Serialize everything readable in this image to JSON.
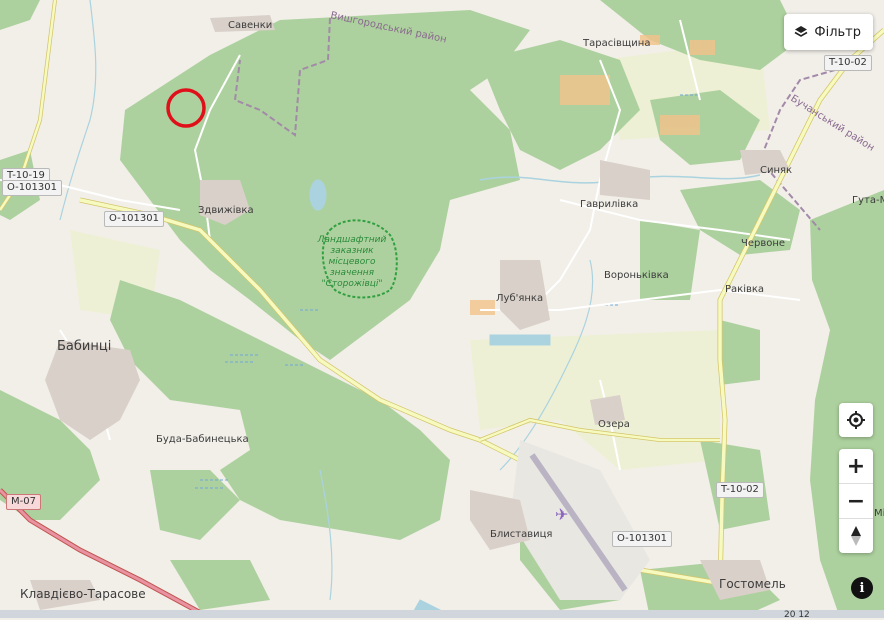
{
  "map": {
    "place_labels": {
      "savenky": "Савенки",
      "zdvyzhivka": "Здвижівка",
      "babyntsi": "Бабинці",
      "buda_babynetska": "Буда-Бабинецька",
      "kladivo_tarasove": "Клавдієво-Тарасове",
      "tarasivshchyna": "Тарасівщина",
      "havrylivka": "Гаврилівка",
      "syniak": "Синяк",
      "huta_m": "Гута-М",
      "chervone": "Червоне",
      "vorontsivka": "Вороньківка",
      "rakivka": "Раківка",
      "lubianka": "Луб'янка",
      "ozera": "Озера",
      "blystavytsia": "Блиставиця",
      "hostomel": "Гостомель",
      "mis": "Міс"
    },
    "district_labels": {
      "vyshhorod": "Вишгородський район",
      "bucha": "Бучанський район"
    },
    "reserve_label": [
      "Ландшафтний",
      "заказник",
      "місцевого",
      "значення",
      "\"Сторожівці\""
    ],
    "road_shields": {
      "t1019": "T-10-19",
      "o101301_a": "O-101301",
      "o101301_b": "O-101301",
      "o101301_c": "O-101301",
      "m07": "M-07",
      "t1002_a": "T-10-02",
      "t1002_b": "T-10-02"
    },
    "marker": {
      "shape": "circle-outline",
      "color": "#e0101a"
    },
    "scale_text": "20 12"
  },
  "controls": {
    "filter_label": "Фільтр",
    "filter_icon": "layers-icon",
    "locate_icon": "crosshair-icon",
    "zoom_in_label": "+",
    "zoom_out_label": "−",
    "north_icon": "compass-north-icon",
    "info_label": "i"
  },
  "colors": {
    "forest": "#add19e",
    "background": "#f2efe9",
    "farmland": "#eef0d5",
    "marker": "#e0101a",
    "primary_road": "#f7fabf",
    "water": "#aad3df"
  }
}
